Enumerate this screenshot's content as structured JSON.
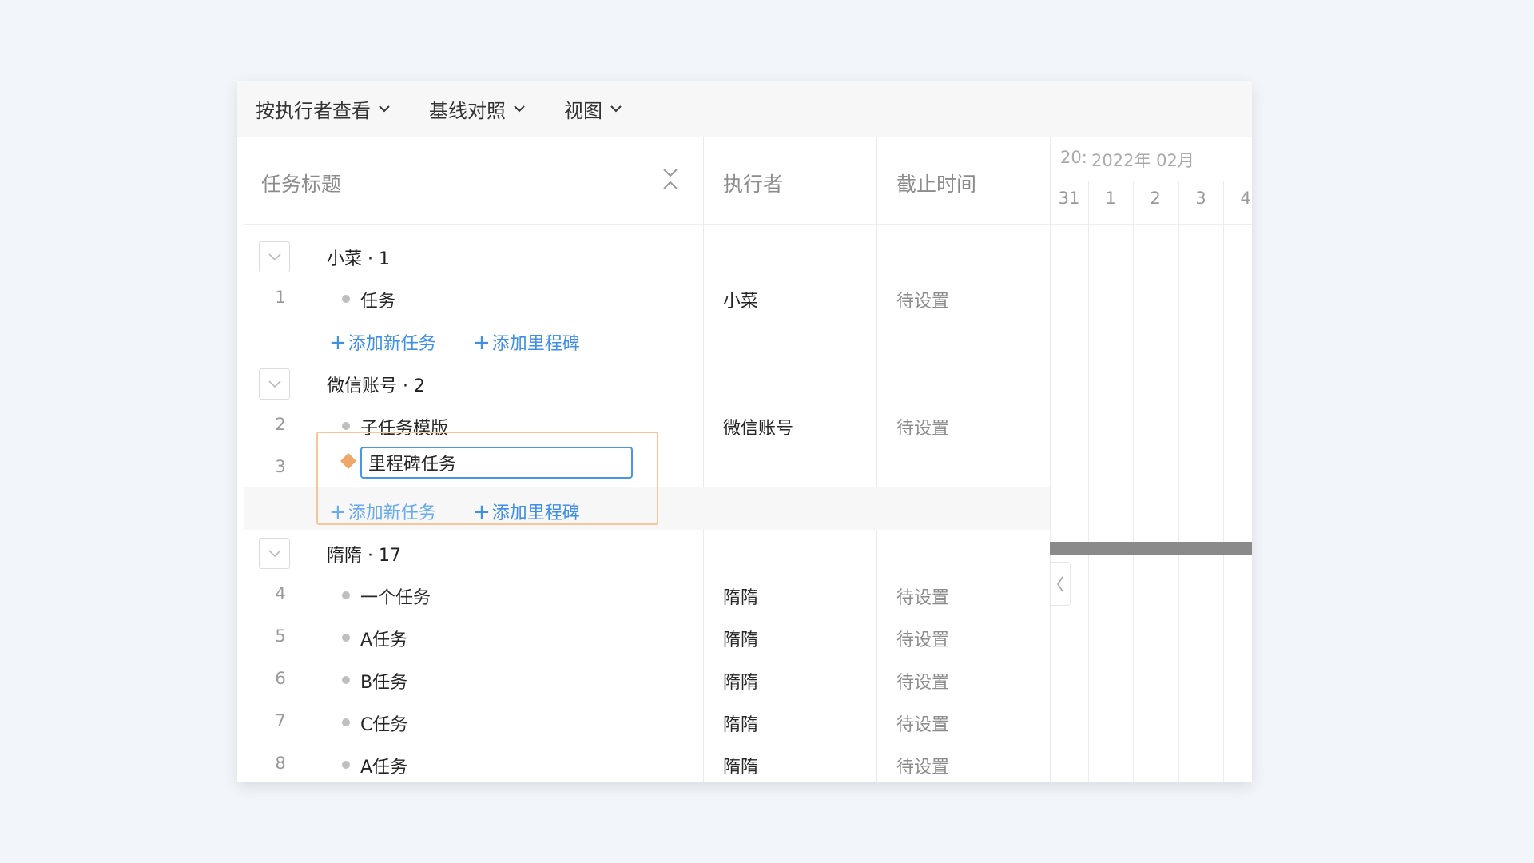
{
  "toolbar": {
    "view_by": "按执行者查看",
    "baseline": "基线对照",
    "view": "视图"
  },
  "headers": {
    "title": "任务标题",
    "executor": "执行者",
    "due": "截止时间",
    "gantt_year_stub": "20:",
    "gantt_month": "2022年 02月",
    "gantt_days": [
      "31",
      "1",
      "2",
      "3",
      "4"
    ]
  },
  "groups": [
    {
      "title": "小菜 · 1",
      "tasks": [
        {
          "num": "1",
          "title": "任务",
          "executor": "小菜",
          "due": "待设置"
        }
      ],
      "add_task": "添加新任务",
      "add_milestone": "添加里程碑"
    },
    {
      "title": "微信账号 · 2",
      "tasks": [
        {
          "num": "2",
          "title": "子任务模版",
          "executor": "微信账号",
          "due": "待设置"
        }
      ],
      "editing": {
        "num": "3",
        "value": "里程碑任务"
      },
      "add_task": "添加新任务",
      "add_milestone": "添加里程碑"
    },
    {
      "title": "隋隋 · 17",
      "tasks": [
        {
          "num": "4",
          "title": "一个任务",
          "executor": "隋隋",
          "due": "待设置"
        },
        {
          "num": "5",
          "title": "A任务",
          "executor": "隋隋",
          "due": "待设置"
        },
        {
          "num": "6",
          "title": "B任务",
          "executor": "隋隋",
          "due": "待设置"
        },
        {
          "num": "7",
          "title": "C任务",
          "executor": "隋隋",
          "due": "待设置"
        },
        {
          "num": "8",
          "title": "A任务",
          "executor": "隋隋",
          "due": "待设置"
        }
      ]
    }
  ],
  "colors": {
    "accent": "#3f8fe6",
    "milestone": "#f0a86a",
    "highlight_border": "#f6c59a",
    "gantt_bar": "#8a8a8a"
  }
}
